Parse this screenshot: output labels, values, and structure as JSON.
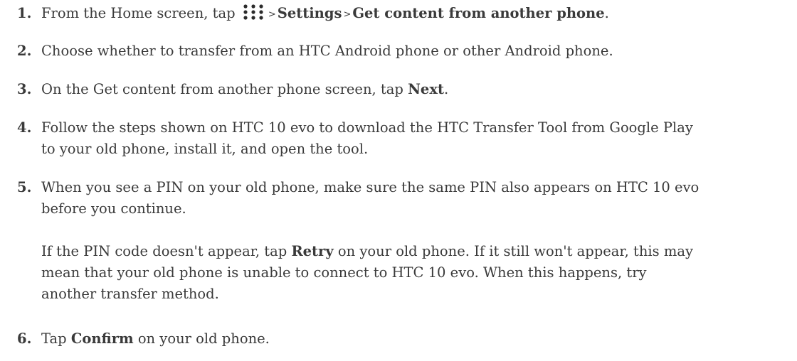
{
  "steps": [
    {
      "num": "1.",
      "pre": "From the Home screen, tap",
      "sep": ">",
      "settings": "Settings",
      "target": "Get content from another phone",
      "post": "."
    },
    {
      "num": "2.",
      "text": "Choose whether to transfer from an HTC Android phone or other Android phone."
    },
    {
      "num": "3.",
      "pre": "On the Get content from another phone screen, tap",
      "bold": "Next",
      "post": "."
    },
    {
      "num": "4.",
      "line1": "Follow the steps shown on HTC 10 evo to download the HTC Transfer Tool from Google Play",
      "line2": "to your old phone, install it, and open the tool."
    },
    {
      "num": "5.",
      "line1": "When you see a PIN on your old phone, make sure the same PIN also appears on HTC 10 evo",
      "line2": "before you continue.",
      "note": {
        "pre": "If the PIN code doesn't appear, tap",
        "bold": "Retry",
        "post_line1": "on your old phone. If it still won't appear, this may",
        "line2": "mean that your old phone is unable to connect to HTC 10 evo. When this happens, try",
        "line3": "another transfer method."
      }
    },
    {
      "num": "6.",
      "pre": "Tap",
      "bold": "Confirm",
      "post": "on your old phone."
    }
  ],
  "icons": {
    "apps": "apps-grid-icon"
  }
}
